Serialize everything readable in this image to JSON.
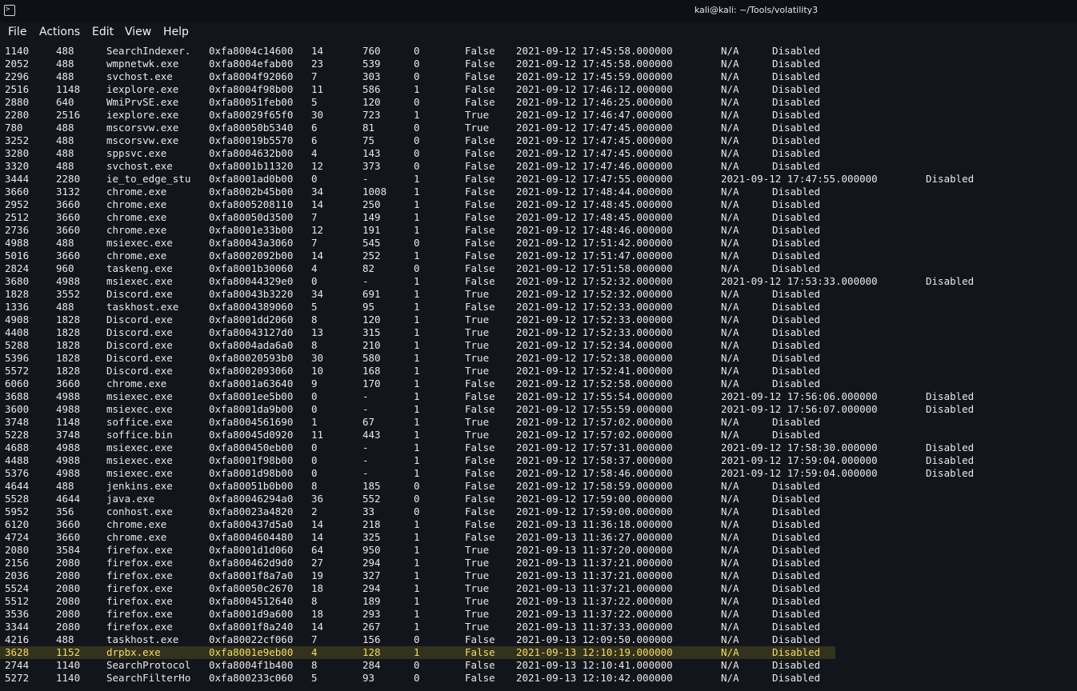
{
  "window": {
    "title": "kali@kali: ~/Tools/volatility3",
    "icon": "terminal-icon"
  },
  "menu": [
    "File",
    "Actions",
    "Edit",
    "View",
    "Help"
  ],
  "highlighted_row": 47,
  "rows": [
    [
      "1140",
      "488",
      "SearchIndexer.",
      "0xfa8004c14600",
      "14",
      "760",
      "0",
      "False",
      "2021-09-12 17:45:58.000000",
      "N/A",
      "Disabled"
    ],
    [
      "2052",
      "488",
      "wmpnetwk.exe",
      "0xfa8004efab00",
      "23",
      "539",
      "0",
      "False",
      "2021-09-12 17:45:58.000000",
      "N/A",
      "Disabled"
    ],
    [
      "2296",
      "488",
      "svchost.exe",
      "0xfa8004f92060",
      "7",
      "303",
      "0",
      "False",
      "2021-09-12 17:45:59.000000",
      "N/A",
      "Disabled"
    ],
    [
      "2516",
      "1148",
      "iexplore.exe",
      "0xfa8004f98b00",
      "11",
      "586",
      "1",
      "False",
      "2021-09-12 17:46:12.000000",
      "N/A",
      "Disabled"
    ],
    [
      "2880",
      "640",
      "WmiPrvSE.exe",
      "0xfa80051feb00",
      "5",
      "120",
      "0",
      "False",
      "2021-09-12 17:46:25.000000",
      "N/A",
      "Disabled"
    ],
    [
      "2280",
      "2516",
      "iexplore.exe",
      "0xfa80029f65f0",
      "30",
      "723",
      "1",
      "True",
      "2021-09-12 17:46:47.000000",
      "N/A",
      "Disabled"
    ],
    [
      "780",
      "488",
      "mscorsvw.exe",
      "0xfa80050b5340",
      "6",
      "81",
      "0",
      "True",
      "2021-09-12 17:47:45.000000",
      "N/A",
      "Disabled"
    ],
    [
      "3252",
      "488",
      "mscorsvw.exe",
      "0xfa80019b5570",
      "6",
      "75",
      "0",
      "False",
      "2021-09-12 17:47:45.000000",
      "N/A",
      "Disabled"
    ],
    [
      "3280",
      "488",
      "sppsvc.exe",
      "0xfa8004632b00",
      "4",
      "143",
      "0",
      "False",
      "2021-09-12 17:47:45.000000",
      "N/A",
      "Disabled"
    ],
    [
      "3320",
      "488",
      "svchost.exe",
      "0xfa8001b11320",
      "12",
      "373",
      "0",
      "False",
      "2021-09-12 17:47:46.000000",
      "N/A",
      "Disabled"
    ],
    [
      "3444",
      "2280",
      "ie_to_edge_stu",
      "0xfa8001ad0b00",
      "0",
      "-",
      "1",
      "False",
      "2021-09-12 17:47:55.000000",
      "2021-09-12 17:47:55.000000",
      "Disabled"
    ],
    [
      "3660",
      "3132",
      "chrome.exe",
      "0xfa8002b45b00",
      "34",
      "1008",
      "1",
      "False",
      "2021-09-12 17:48:44.000000",
      "N/A",
      "Disabled"
    ],
    [
      "2952",
      "3660",
      "chrome.exe",
      "0xfa8005208110",
      "14",
      "250",
      "1",
      "False",
      "2021-09-12 17:48:45.000000",
      "N/A",
      "Disabled"
    ],
    [
      "2512",
      "3660",
      "chrome.exe",
      "0xfa80050d3500",
      "7",
      "149",
      "1",
      "False",
      "2021-09-12 17:48:45.000000",
      "N/A",
      "Disabled"
    ],
    [
      "2736",
      "3660",
      "chrome.exe",
      "0xfa8001e33b00",
      "12",
      "191",
      "1",
      "False",
      "2021-09-12 17:48:46.000000",
      "N/A",
      "Disabled"
    ],
    [
      "4988",
      "488",
      "msiexec.exe",
      "0xfa80043a3060",
      "7",
      "545",
      "0",
      "False",
      "2021-09-12 17:51:42.000000",
      "N/A",
      "Disabled"
    ],
    [
      "5016",
      "3660",
      "chrome.exe",
      "0xfa8002092b00",
      "14",
      "252",
      "1",
      "False",
      "2021-09-12 17:51:47.000000",
      "N/A",
      "Disabled"
    ],
    [
      "2824",
      "960",
      "taskeng.exe",
      "0xfa8001b30060",
      "4",
      "82",
      "0",
      "False",
      "2021-09-12 17:51:58.000000",
      "N/A",
      "Disabled"
    ],
    [
      "3680",
      "4988",
      "msiexec.exe",
      "0xfa80044329e0",
      "0",
      "-",
      "1",
      "False",
      "2021-09-12 17:52:32.000000",
      "2021-09-12 17:53:33.000000",
      "Disabled"
    ],
    [
      "1828",
      "3552",
      "Discord.exe",
      "0xfa80043b3220",
      "34",
      "691",
      "1",
      "True",
      "2021-09-12 17:52:32.000000",
      "N/A",
      "Disabled"
    ],
    [
      "1336",
      "488",
      "taskhost.exe",
      "0xfa8004389060",
      "5",
      "95",
      "1",
      "False",
      "2021-09-12 17:52:33.000000",
      "N/A",
      "Disabled"
    ],
    [
      "4908",
      "1828",
      "Discord.exe",
      "0xfa8001dd2060",
      "8",
      "120",
      "1",
      "True",
      "2021-09-12 17:52:33.000000",
      "N/A",
      "Disabled"
    ],
    [
      "4408",
      "1828",
      "Discord.exe",
      "0xfa80043127d0",
      "13",
      "315",
      "1",
      "True",
      "2021-09-12 17:52:33.000000",
      "N/A",
      "Disabled"
    ],
    [
      "5288",
      "1828",
      "Discord.exe",
      "0xfa8004ada6a0",
      "8",
      "210",
      "1",
      "True",
      "2021-09-12 17:52:34.000000",
      "N/A",
      "Disabled"
    ],
    [
      "5396",
      "1828",
      "Discord.exe",
      "0xfa80020593b0",
      "30",
      "580",
      "1",
      "True",
      "2021-09-12 17:52:38.000000",
      "N/A",
      "Disabled"
    ],
    [
      "5572",
      "1828",
      "Discord.exe",
      "0xfa8002093060",
      "10",
      "168",
      "1",
      "True",
      "2021-09-12 17:52:41.000000",
      "N/A",
      "Disabled"
    ],
    [
      "6060",
      "3660",
      "chrome.exe",
      "0xfa8001a63640",
      "9",
      "170",
      "1",
      "False",
      "2021-09-12 17:52:58.000000",
      "N/A",
      "Disabled"
    ],
    [
      "3688",
      "4988",
      "msiexec.exe",
      "0xfa8001ee5b00",
      "0",
      "-",
      "1",
      "False",
      "2021-09-12 17:55:54.000000",
      "2021-09-12 17:56:06.000000",
      "Disabled"
    ],
    [
      "3600",
      "4988",
      "msiexec.exe",
      "0xfa8001da9b00",
      "0",
      "-",
      "1",
      "False",
      "2021-09-12 17:55:59.000000",
      "2021-09-12 17:56:07.000000",
      "Disabled"
    ],
    [
      "3748",
      "1148",
      "soffice.exe",
      "0xfa8004561690",
      "1",
      "67",
      "1",
      "True",
      "2021-09-12 17:57:02.000000",
      "N/A",
      "Disabled"
    ],
    [
      "5228",
      "3748",
      "soffice.bin",
      "0xfa80045d0920",
      "11",
      "443",
      "1",
      "True",
      "2021-09-12 17:57:02.000000",
      "N/A",
      "Disabled"
    ],
    [
      "4688",
      "4988",
      "msiexec.exe",
      "0xfa800450eb00",
      "0",
      "-",
      "1",
      "False",
      "2021-09-12 17:57:31.000000",
      "2021-09-12 17:58:30.000000",
      "Disabled"
    ],
    [
      "4488",
      "4988",
      "msiexec.exe",
      "0xfa8001f98b00",
      "0",
      "-",
      "1",
      "False",
      "2021-09-12 17:58:37.000000",
      "2021-09-12 17:59:04.000000",
      "Disabled"
    ],
    [
      "5376",
      "4988",
      "msiexec.exe",
      "0xfa8001d98b00",
      "0",
      "-",
      "1",
      "False",
      "2021-09-12 17:58:46.000000",
      "2021-09-12 17:59:04.000000",
      "Disabled"
    ],
    [
      "4644",
      "488",
      "jenkins.exe",
      "0xfa80051b0b00",
      "8",
      "185",
      "0",
      "False",
      "2021-09-12 17:58:59.000000",
      "N/A",
      "Disabled"
    ],
    [
      "5528",
      "4644",
      "java.exe",
      "0xfa80046294a0",
      "36",
      "552",
      "0",
      "False",
      "2021-09-12 17:59:00.000000",
      "N/A",
      "Disabled"
    ],
    [
      "5952",
      "356",
      "conhost.exe",
      "0xfa80023a4820",
      "2",
      "33",
      "0",
      "False",
      "2021-09-12 17:59:00.000000",
      "N/A",
      "Disabled"
    ],
    [
      "6120",
      "3660",
      "chrome.exe",
      "0xfa800437d5a0",
      "14",
      "218",
      "1",
      "False",
      "2021-09-13 11:36:18.000000",
      "N/A",
      "Disabled"
    ],
    [
      "4724",
      "3660",
      "chrome.exe",
      "0xfa8004604480",
      "14",
      "325",
      "1",
      "False",
      "2021-09-13 11:36:27.000000",
      "N/A",
      "Disabled"
    ],
    [
      "2080",
      "3584",
      "firefox.exe",
      "0xfa8001d1d060",
      "64",
      "950",
      "1",
      "True",
      "2021-09-13 11:37:20.000000",
      "N/A",
      "Disabled"
    ],
    [
      "2156",
      "2080",
      "firefox.exe",
      "0xfa800462d9d0",
      "27",
      "294",
      "1",
      "True",
      "2021-09-13 11:37:21.000000",
      "N/A",
      "Disabled"
    ],
    [
      "2036",
      "2080",
      "firefox.exe",
      "0xfa8001f8a7a0",
      "19",
      "327",
      "1",
      "True",
      "2021-09-13 11:37:21.000000",
      "N/A",
      "Disabled"
    ],
    [
      "5524",
      "2080",
      "firefox.exe",
      "0xfa80050c2670",
      "18",
      "294",
      "1",
      "True",
      "2021-09-13 11:37:21.000000",
      "N/A",
      "Disabled"
    ],
    [
      "5512",
      "2080",
      "firefox.exe",
      "0xfa8004512640",
      "8",
      "189",
      "1",
      "True",
      "2021-09-13 11:37:22.000000",
      "N/A",
      "Disabled"
    ],
    [
      "3536",
      "2080",
      "firefox.exe",
      "0xfa8001d9a600",
      "18",
      "293",
      "1",
      "True",
      "2021-09-13 11:37:22.000000",
      "N/A",
      "Disabled"
    ],
    [
      "3344",
      "2080",
      "firefox.exe",
      "0xfa8001f8a240",
      "14",
      "267",
      "1",
      "True",
      "2021-09-13 11:37:33.000000",
      "N/A",
      "Disabled"
    ],
    [
      "4216",
      "488",
      "taskhost.exe",
      "0xfa80022cf060",
      "7",
      "156",
      "0",
      "False",
      "2021-09-13 12:09:50.000000",
      "N/A",
      "Disabled"
    ],
    [
      "3628",
      "1152",
      "drpbx.exe",
      "0xfa8001e9eb00",
      "4",
      "128",
      "1",
      "False",
      "2021-09-13 12:10:19.000000",
      "N/A",
      "Disabled"
    ],
    [
      "2744",
      "1140",
      "SearchProtocol",
      "0xfa8004f1b400",
      "8",
      "284",
      "0",
      "False",
      "2021-09-13 12:10:41.000000",
      "N/A",
      "Disabled"
    ],
    [
      "5272",
      "1140",
      "SearchFilterHo",
      "0xfa800233c060",
      "5",
      "93",
      "0",
      "False",
      "2021-09-13 12:10:42.000000",
      "N/A",
      "Disabled"
    ]
  ]
}
